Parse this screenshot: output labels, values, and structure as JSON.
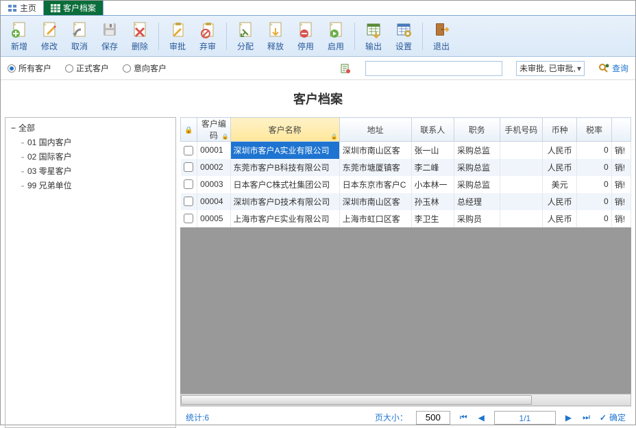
{
  "tabs": {
    "home": "主页",
    "active": "客户档案"
  },
  "toolbar": [
    {
      "key": "add",
      "label": "新增"
    },
    {
      "key": "edit",
      "label": "修改"
    },
    {
      "key": "cancel",
      "label": "取消"
    },
    {
      "key": "save",
      "label": "保存"
    },
    {
      "key": "delete",
      "label": "删除"
    },
    {
      "key": "approve",
      "label": "审批"
    },
    {
      "key": "unapprove",
      "label": "弃审"
    },
    {
      "key": "assign",
      "label": "分配"
    },
    {
      "key": "release",
      "label": "释放"
    },
    {
      "key": "disable",
      "label": "停用"
    },
    {
      "key": "enable",
      "label": "启用"
    },
    {
      "key": "export",
      "label": "输出"
    },
    {
      "key": "settings",
      "label": "设置"
    },
    {
      "key": "exit",
      "label": "退出"
    }
  ],
  "filters": {
    "radios": [
      {
        "key": "all",
        "label": "所有客户",
        "checked": true
      },
      {
        "key": "formal",
        "label": "正式客户",
        "checked": false
      },
      {
        "key": "intent",
        "label": "意向客户",
        "checked": false
      }
    ],
    "search_value": "",
    "status_select": "未审批, 已审批,",
    "query_label": "查询"
  },
  "title": "客户档案",
  "tree": {
    "root": "全部",
    "children": [
      {
        "code": "01",
        "label": "国内客户"
      },
      {
        "code": "02",
        "label": "国际客户"
      },
      {
        "code": "03",
        "label": "零星客户"
      },
      {
        "code": "99",
        "label": "兄弟单位"
      }
    ]
  },
  "grid": {
    "columns": [
      "",
      "客户编码",
      "客户名称",
      "地址",
      "联系人",
      "职务",
      "手机号码",
      "币种",
      "税率",
      ""
    ],
    "sorted_col": 2,
    "rows": [
      {
        "code": "00001",
        "name": "深圳市客户A实业有限公司",
        "addr": "深圳市南山区客",
        "contact": "张一山",
        "title": "采购总监",
        "phone": "",
        "currency": "人民币",
        "tax": "0",
        "last": "销!",
        "selected": true
      },
      {
        "code": "00002",
        "name": "东莞市客户B科技有限公司",
        "addr": "东莞市塘厦镇客",
        "contact": "李二峰",
        "title": "采购总监",
        "phone": "",
        "currency": "人民币",
        "tax": "0",
        "last": "销!"
      },
      {
        "code": "00003",
        "name": "日本客户C株式社集团公司",
        "addr": "日本东京市客户C",
        "contact": "小本林一",
        "title": "采购总监",
        "phone": "",
        "currency": "美元",
        "tax": "0",
        "last": "销!"
      },
      {
        "code": "00004",
        "name": "深圳市客户D技术有限公司",
        "addr": "深圳市南山区客",
        "contact": "孙玉林",
        "title": "总经理",
        "phone": "",
        "currency": "人民币",
        "tax": "0",
        "last": "销!"
      },
      {
        "code": "00005",
        "name": "上海市客户E实业有限公司",
        "addr": "上海市虹口区客",
        "contact": "李卫生",
        "title": "采购员",
        "phone": "",
        "currency": "人民币",
        "tax": "0",
        "last": "销!"
      }
    ]
  },
  "pager": {
    "stats_label": "统计:6",
    "page_size_label": "页大小：",
    "page_size_value": "500",
    "page_display": "1/1",
    "ok_label": "确定"
  }
}
